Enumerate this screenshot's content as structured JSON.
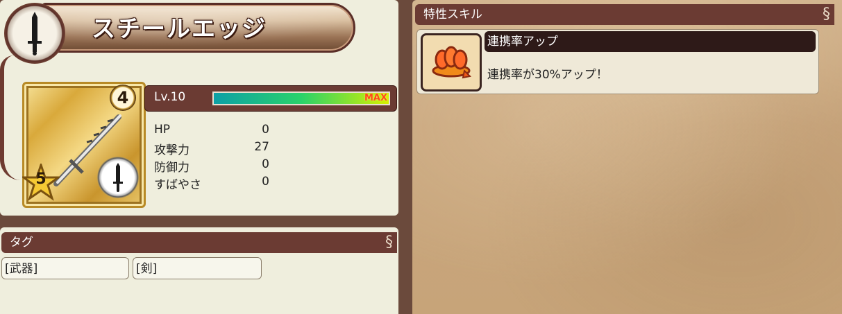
{
  "item": {
    "name": "スチールエッジ",
    "type_icon": "sword-icon",
    "rank": "4",
    "rarity": "5"
  },
  "level": {
    "label": "Lv.10",
    "max_label": "MAX",
    "progress": 1.0
  },
  "stats": [
    {
      "label": "HP",
      "value": "0"
    },
    {
      "label": "攻撃力",
      "value": "27"
    },
    {
      "label": "防御力",
      "value": "0"
    },
    {
      "label": "すばやさ",
      "value": "0"
    }
  ],
  "tags": {
    "header": "タグ",
    "items": [
      "[武器]",
      "[剣]"
    ]
  },
  "skills": {
    "header": "特性スキル",
    "items": [
      {
        "title": "連携率アップ",
        "description": "連携率が30%アップ！",
        "icon": "link-boost-icon"
      }
    ]
  },
  "colors": {
    "panel": "#efeedd",
    "frame": "#6b4a3c",
    "header": "#6b3b33",
    "max": "#ff4a1a"
  }
}
